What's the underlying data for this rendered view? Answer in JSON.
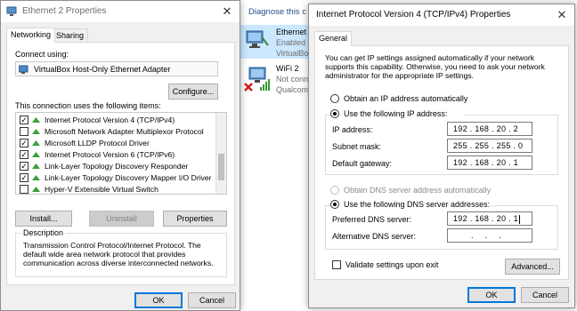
{
  "left_window": {
    "title": "Ethernet 2 Properties",
    "tabs": [
      "Networking",
      "Sharing"
    ],
    "connect_using_label": "Connect using:",
    "adapter_name": "VirtualBox Host-Only Ethernet Adapter",
    "configure_label": "Configure...",
    "items_label": "This connection uses the following items:",
    "items": [
      {
        "label": "Internet Protocol Version 4 (TCP/IPv4)",
        "checked": true
      },
      {
        "label": "Microsoft Network Adapter Multiplexor Protocol",
        "checked": false
      },
      {
        "label": "Microsoft LLDP Protocol Driver",
        "checked": true
      },
      {
        "label": "Internet Protocol Version 6 (TCP/IPv6)",
        "checked": true
      },
      {
        "label": "Link-Layer Topology Discovery Responder",
        "checked": true
      },
      {
        "label": "Link-Layer Topology Discovery Mapper I/O Driver",
        "checked": true
      },
      {
        "label": "Hyper-V Extensible Virtual Switch",
        "checked": false
      }
    ],
    "install_label": "Install...",
    "uninstall_label": "Uninstall",
    "properties_label": "Properties",
    "description_heading": "Description",
    "description_text": "Transmission Control Protocol/Internet Protocol. The default wide area network protocol that provides communication across diverse interconnected networks.",
    "ok_label": "OK",
    "cancel_label": "Cancel"
  },
  "background": {
    "diagnose_label": "Diagnose this c",
    "conn1_name": "Ethernet",
    "conn1_status": "Enabled",
    "conn1_device": "VirtualBo",
    "conn2_name": "WiFi 2",
    "conn2_status": "Not conn",
    "conn2_device": "Qualcomm"
  },
  "right_window": {
    "title": "Internet Protocol Version 4 (TCP/IPv4) Properties",
    "tab_general": "General",
    "intro_text": "You can get IP settings assigned automatically if your network supports this capability. Otherwise, you need to ask your network administrator for the appropriate IP settings.",
    "obtain_ip_auto": "Obtain an IP address automatically",
    "use_following_ip": "Use the following IP address:",
    "ip_address_label": "IP address:",
    "ip_address_value": "192 . 168 . 20 . 2",
    "subnet_label": "Subnet mask:",
    "subnet_value": "255 . 255 . 255 . 0",
    "gateway_label": "Default gateway:",
    "gateway_value": "192 . 168 . 20 . 1",
    "obtain_dns_auto": "Obtain DNS server address automatically",
    "use_following_dns": "Use the following DNS server addresses:",
    "preferred_dns_label": "Preferred DNS server:",
    "preferred_dns_value": "192 . 168 . 20 . 1",
    "alternate_dns_label": "Alternative DNS server:",
    "alternate_dns_value": ". . .",
    "validate_label": "Validate settings upon exit",
    "advanced_label": "Advanced...",
    "ok_label": "OK",
    "cancel_label": "Cancel"
  },
  "colors": {
    "accent": "#0078d7",
    "link_blue": "#1f4e8c",
    "window_bg": "#f0f0f0"
  }
}
